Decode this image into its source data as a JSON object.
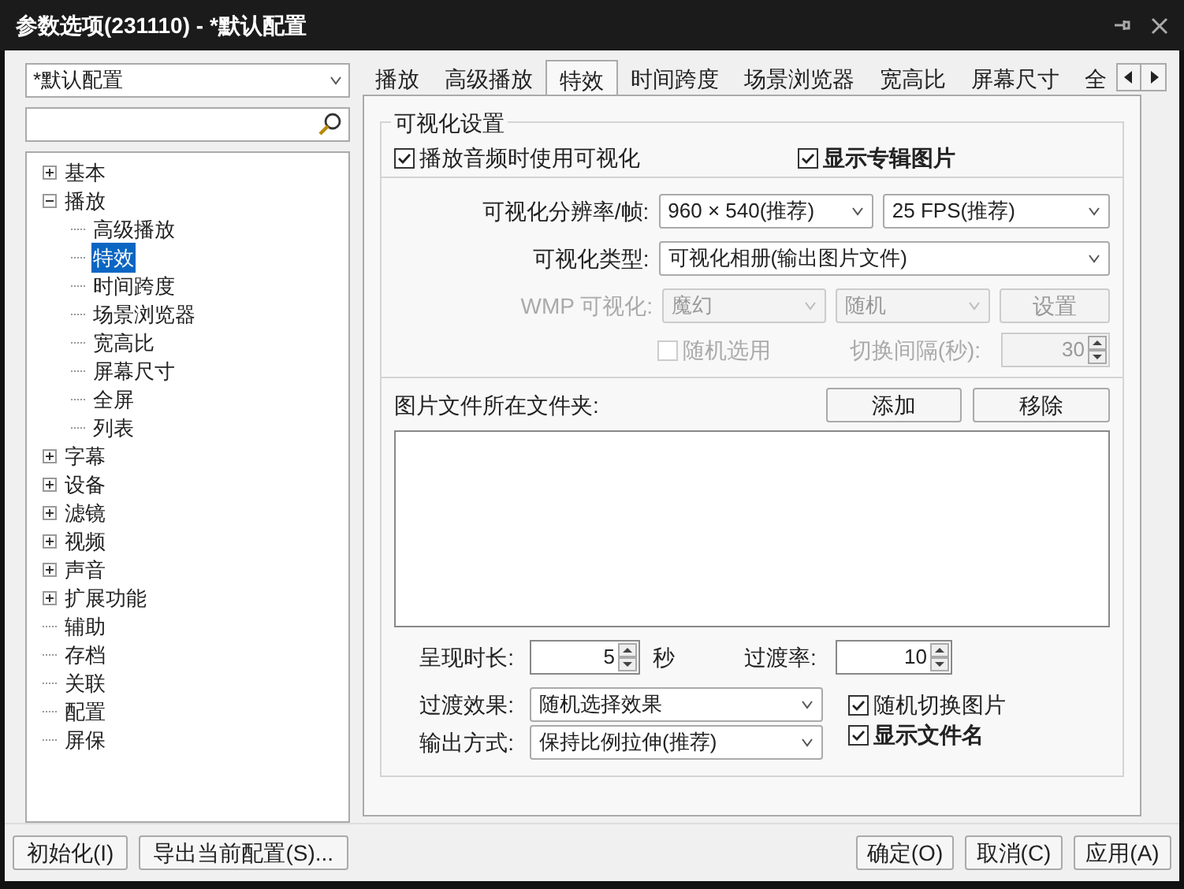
{
  "window": {
    "title": "参数选项(231110) - *默认配置"
  },
  "profile_select": {
    "value": "*默认配置"
  },
  "tree": [
    {
      "label": "基本",
      "expanded": false,
      "selected": false
    },
    {
      "label": "播放",
      "expanded": true,
      "selected": false,
      "children": [
        {
          "label": "高级播放",
          "selected": false
        },
        {
          "label": "特效",
          "selected": true
        },
        {
          "label": "时间跨度",
          "selected": false
        },
        {
          "label": "场景浏览器",
          "selected": false
        },
        {
          "label": "宽高比",
          "selected": false
        },
        {
          "label": "屏幕尺寸",
          "selected": false
        },
        {
          "label": "全屏",
          "selected": false
        },
        {
          "label": "列表",
          "selected": false
        }
      ]
    },
    {
      "label": "字幕",
      "expanded": false,
      "selected": false
    },
    {
      "label": "设备",
      "expanded": false,
      "selected": false
    },
    {
      "label": "滤镜",
      "expanded": false,
      "selected": false
    },
    {
      "label": "视频",
      "expanded": false,
      "selected": false
    },
    {
      "label": "声音",
      "expanded": false,
      "selected": false
    },
    {
      "label": "扩展功能",
      "expanded": false,
      "selected": false
    },
    {
      "label": "辅助",
      "selected": false
    },
    {
      "label": "存档",
      "selected": false
    },
    {
      "label": "关联",
      "selected": false
    },
    {
      "label": "配置",
      "selected": false
    },
    {
      "label": "屏保",
      "selected": false
    }
  ],
  "tabs": [
    {
      "label": "播放",
      "selected": false
    },
    {
      "label": "高级播放",
      "selected": false
    },
    {
      "label": "特效",
      "selected": true
    },
    {
      "label": "时间跨度",
      "selected": false
    },
    {
      "label": "场景浏览器",
      "selected": false
    },
    {
      "label": "宽高比",
      "selected": false
    },
    {
      "label": "屏幕尺寸",
      "selected": false
    },
    {
      "label": "全",
      "selected": false
    }
  ],
  "group": {
    "title": "可视化设置",
    "use_visualization": {
      "label": "播放音频时使用可视化",
      "checked": true
    },
    "show_album_art": {
      "label": "显示专辑图片",
      "checked": true
    },
    "resolution": {
      "label": "可视化分辨率/帧:",
      "size": "960 × 540(推荐)",
      "fps": "25 FPS(推荐)"
    },
    "type": {
      "label": "可视化类型:",
      "value": "可视化相册(输出图片文件)"
    },
    "wmp": {
      "label": "WMP 可视化:",
      "disabled": true,
      "effect": "魔幻",
      "mode": "随机",
      "button": "设置"
    },
    "random_pick": {
      "label": "随机选用",
      "checked": false,
      "disabled": true
    },
    "interval": {
      "label": "切换间隔(秒):",
      "value": "30",
      "disabled": true
    },
    "folders": {
      "label": "图片文件所在文件夹:",
      "add": "添加",
      "remove": "移除"
    },
    "duration": {
      "label": "呈现时长:",
      "value": "5",
      "unit": "秒"
    },
    "transition_rate": {
      "label": "过渡率:",
      "value": "10"
    },
    "transition_effect": {
      "label": "过渡效果:",
      "value": "随机选择效果"
    },
    "random_switch": {
      "label": "随机切换图片",
      "checked": true
    },
    "output_mode": {
      "label": "输出方式:",
      "value": "保持比例拉伸(推荐)"
    },
    "show_filename": {
      "label": "显示文件名",
      "checked": true
    }
  },
  "footer": {
    "left": [
      "初始化(I)",
      "导出当前配置(S)..."
    ],
    "right": [
      "确定(O)",
      "取消(C)",
      "应用(A)"
    ]
  }
}
